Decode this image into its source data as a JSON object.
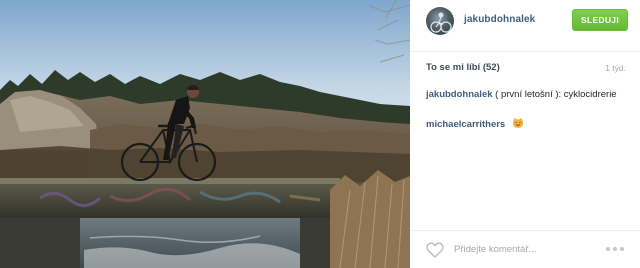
{
  "post": {
    "author": {
      "username": "jakubdohnalek",
      "avatar_icon": "avatar-cyclist"
    },
    "follow_button": "SLEDUJI",
    "likes_text": "To se mi líbí (52)",
    "age": "1 týd.",
    "caption": {
      "author": "jakubdohnalek",
      "text": " ( první letošní ): cyklocidrerie"
    },
    "comments": [
      {
        "author": "michaelcarrithers",
        "emoji": "cat-smile-icon"
      }
    ],
    "add_comment": {
      "placeholder": "Přidejte komentář..."
    },
    "icons": {
      "like": "heart-icon",
      "more": "more-options-icon"
    },
    "colors": {
      "username": "#3f5e7e",
      "follow_button": "#70c442",
      "muted_text": "#a5a7aa"
    },
    "photo": {
      "scene": "cyclist-on-bridge-over-river"
    }
  }
}
